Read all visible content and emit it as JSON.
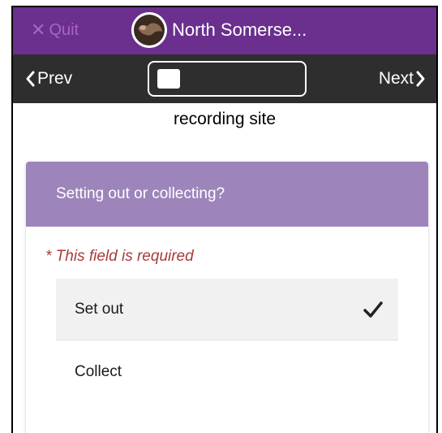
{
  "header": {
    "quit_label": "Quit",
    "title": "North Somerse..."
  },
  "nav": {
    "prev_label": "Prev",
    "next_label": "Next",
    "progress": 0.16
  },
  "page": {
    "heading": "recording site"
  },
  "question": {
    "label": "Setting out or collecting?",
    "required_text": "* This field is required",
    "options": [
      {
        "label": "Set out",
        "selected": true
      },
      {
        "label": "Collect",
        "selected": false
      }
    ]
  },
  "colors": {
    "header_bg": "#6b2f8e",
    "nav_bg": "#2e2e2e",
    "question_header_bg": "#9d85bb",
    "required_text": "#a73b3b"
  },
  "icons": [
    "close-icon",
    "app-logo-icon",
    "chevron-left-icon",
    "chevron-right-icon",
    "checkmark-icon"
  ]
}
